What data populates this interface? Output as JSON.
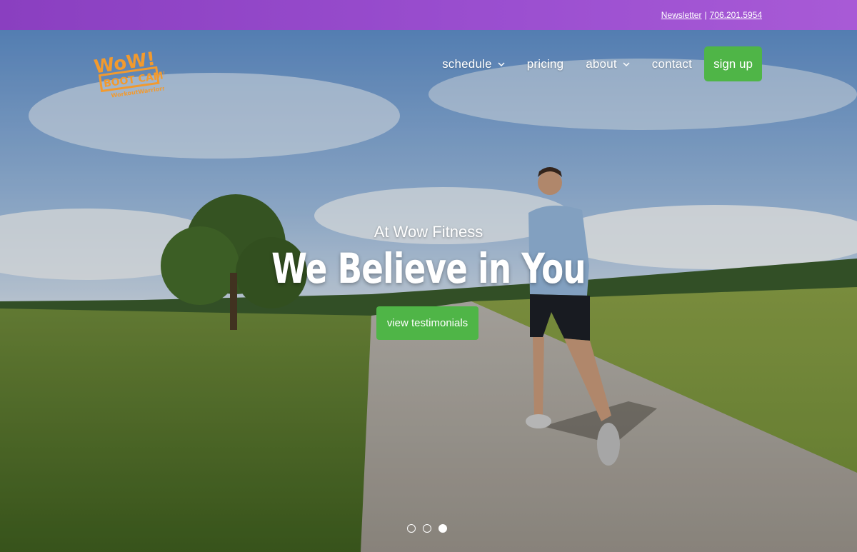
{
  "topbar": {
    "newsletter": "Newsletter",
    "separator": "|",
    "phone": "706.201.5954"
  },
  "logo": {
    "line1": "WoW!",
    "line2": "BOOT CAMP",
    "line3": "WorkoutWarriors"
  },
  "nav": {
    "items": [
      {
        "label": "schedule",
        "dropdown": true
      },
      {
        "label": "pricing",
        "dropdown": false
      },
      {
        "label": "about",
        "dropdown": true
      },
      {
        "label": "contact",
        "dropdown": false
      }
    ],
    "signup": "sign up"
  },
  "hero": {
    "eyebrow": "At Wow Fitness",
    "headline": "We Believe in You",
    "cta": "view testimonials",
    "slides": 3,
    "active_slide": 3
  },
  "colors": {
    "topbar": "#9b4fd0",
    "accent_green": "#4fb547",
    "logo_orange": "#f29a2e"
  }
}
